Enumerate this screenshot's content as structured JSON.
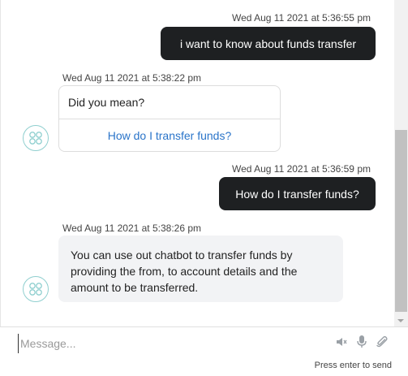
{
  "messages": [
    {
      "timestamp": "Wed Aug 11 2021 at 5:36:55 pm",
      "text": "i want to know about funds transfer"
    },
    {
      "timestamp": "Wed Aug 11 2021 at 5:38:22 pm",
      "title": "Did you mean?",
      "option": "How do I transfer funds?"
    },
    {
      "timestamp": "Wed Aug 11 2021 at 5:36:59 pm",
      "text": "How do I transfer funds?"
    },
    {
      "timestamp": "Wed Aug 11 2021 at 5:38:26 pm",
      "text": "You can use out chatbot to transfer funds by providing the from, to account details and the amount to be transferred."
    }
  ],
  "composer": {
    "placeholder": "Message...",
    "hint": "Press enter to send"
  },
  "icons": {
    "avatar": "bot-avatar-icon",
    "mute": "speaker-mute-icon",
    "mic": "microphone-icon",
    "attach": "paperclip-icon"
  },
  "colors": {
    "user_bubble": "#1e2022",
    "bot_bubble": "#f2f3f5",
    "link": "#2a74c9",
    "avatar_ring": "#8fcfcf"
  }
}
